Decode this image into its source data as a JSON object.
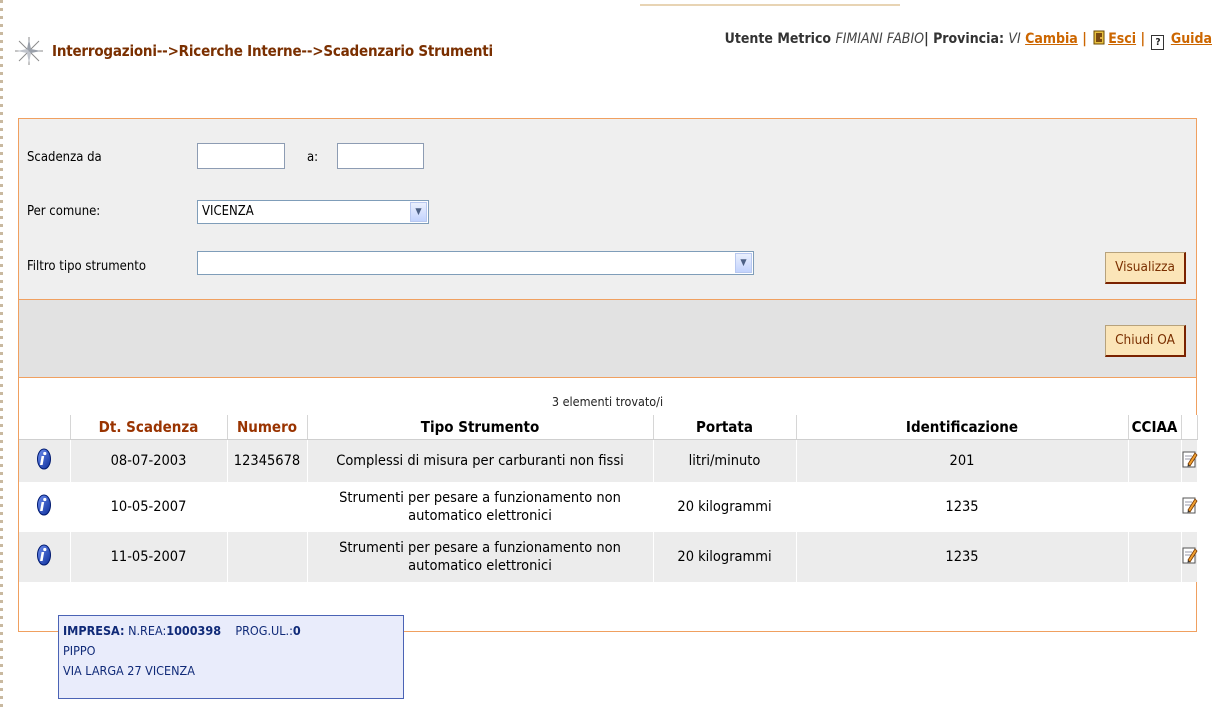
{
  "header": {
    "breadcrumb": "Interrogazioni-->Ricerche Interne-->Scadenzario Strumenti",
    "user_label": "Utente Metrico",
    "user_name": "FIMIANI FABIO",
    "provincia_label": "Provincia:",
    "provincia_value": "VI",
    "cambia": "Cambia",
    "esci": "Esci",
    "guida": "Guida",
    "guida_icon_text": "?"
  },
  "filters": {
    "scadenza_da_label": "Scadenza da",
    "scadenza_da_value": "",
    "a_label": "a:",
    "a_value": "",
    "comune_label": "Per comune:",
    "comune_value": "VICENZA",
    "tipo_label": "Filtro tipo strumento",
    "tipo_value": "",
    "visualizza": "Visualizza",
    "chiudi_oa": "Chiudi OA"
  },
  "results": {
    "count_text": "3 elementi trovato/i",
    "columns": [
      "",
      "Dt. Scadenza",
      "Numero",
      "Tipo Strumento",
      "Portata",
      "Identificazione",
      "CCIAA",
      ""
    ],
    "rows": [
      {
        "scadenza": "08-07-2003",
        "numero": "12345678",
        "tipo": "Complessi di misura per carburanti non fissi",
        "portata": "litri/minuto",
        "identificazione": "201",
        "cciaa": ""
      },
      {
        "scadenza": "10-05-2007",
        "numero": "",
        "tipo": "Strumenti per pesare a funzionamento non automatico elettronici",
        "portata": "20 kilogrammi",
        "identificazione": "1235",
        "cciaa": ""
      },
      {
        "scadenza": "11-05-2007",
        "numero": "",
        "tipo": "Strumenti per pesare a funzionamento non automatico elettronici",
        "portata": "20 kilogrammi",
        "identificazione": "1235",
        "cciaa": ""
      }
    ]
  },
  "tooltip": {
    "impresa_label": "IMPRESA:",
    "nrea_label": "N.REA:",
    "nrea_value": "1000398",
    "progul_label": "PROG.UL.:",
    "progul_value": "0",
    "name": "PIPPO",
    "address": "VIA LARGA 27 VICENZA"
  },
  "colors": {
    "accent": "#cc6600",
    "breadcrumb": "#7a2f00",
    "panel_border": "#f0a060"
  },
  "icons": [
    "compass-icon",
    "esci-door-icon",
    "guida-help-icon",
    "info-icon",
    "edit-icon",
    "chevron-down-icon"
  ]
}
